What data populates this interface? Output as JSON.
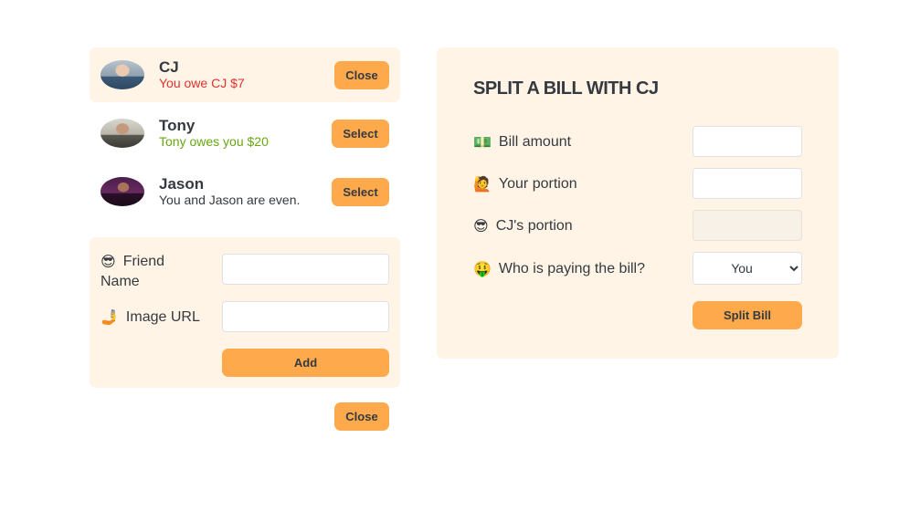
{
  "friends": [
    {
      "name": "CJ",
      "status": "You owe CJ $7",
      "status_type": "owe",
      "button": "Close",
      "selected": true
    },
    {
      "name": "Tony",
      "status": "Tony owes you $20",
      "status_type": "owed",
      "button": "Select",
      "selected": false
    },
    {
      "name": "Jason",
      "status": "You and Jason are even.",
      "status_type": "even",
      "button": "Select",
      "selected": false
    }
  ],
  "add_friend": {
    "name_emoji": "😎",
    "name_label_line1": "Friend",
    "name_label_line2": "Name",
    "name_value": "",
    "image_emoji": "🤳",
    "image_label": "Image URL",
    "image_value": "",
    "add_button": "Add"
  },
  "close_button": "Close",
  "split_bill": {
    "title": "SPLIT A BILL WITH CJ",
    "bill_emoji": "💵",
    "bill_label": "Bill amount",
    "bill_value": "",
    "your_emoji": "🙋",
    "your_label": "Your portion",
    "your_value": "",
    "friend_emoji": "😎",
    "friend_label": "CJ's portion",
    "friend_value": "",
    "payer_emoji": "🤑",
    "payer_label": "Who is paying the bill?",
    "payer_selected": "You",
    "submit_button": "Split Bill"
  },
  "colors": {
    "accent": "#ffa94d",
    "panel": "#fff4e6",
    "owe": "#e03131",
    "owed": "#66a80f"
  }
}
